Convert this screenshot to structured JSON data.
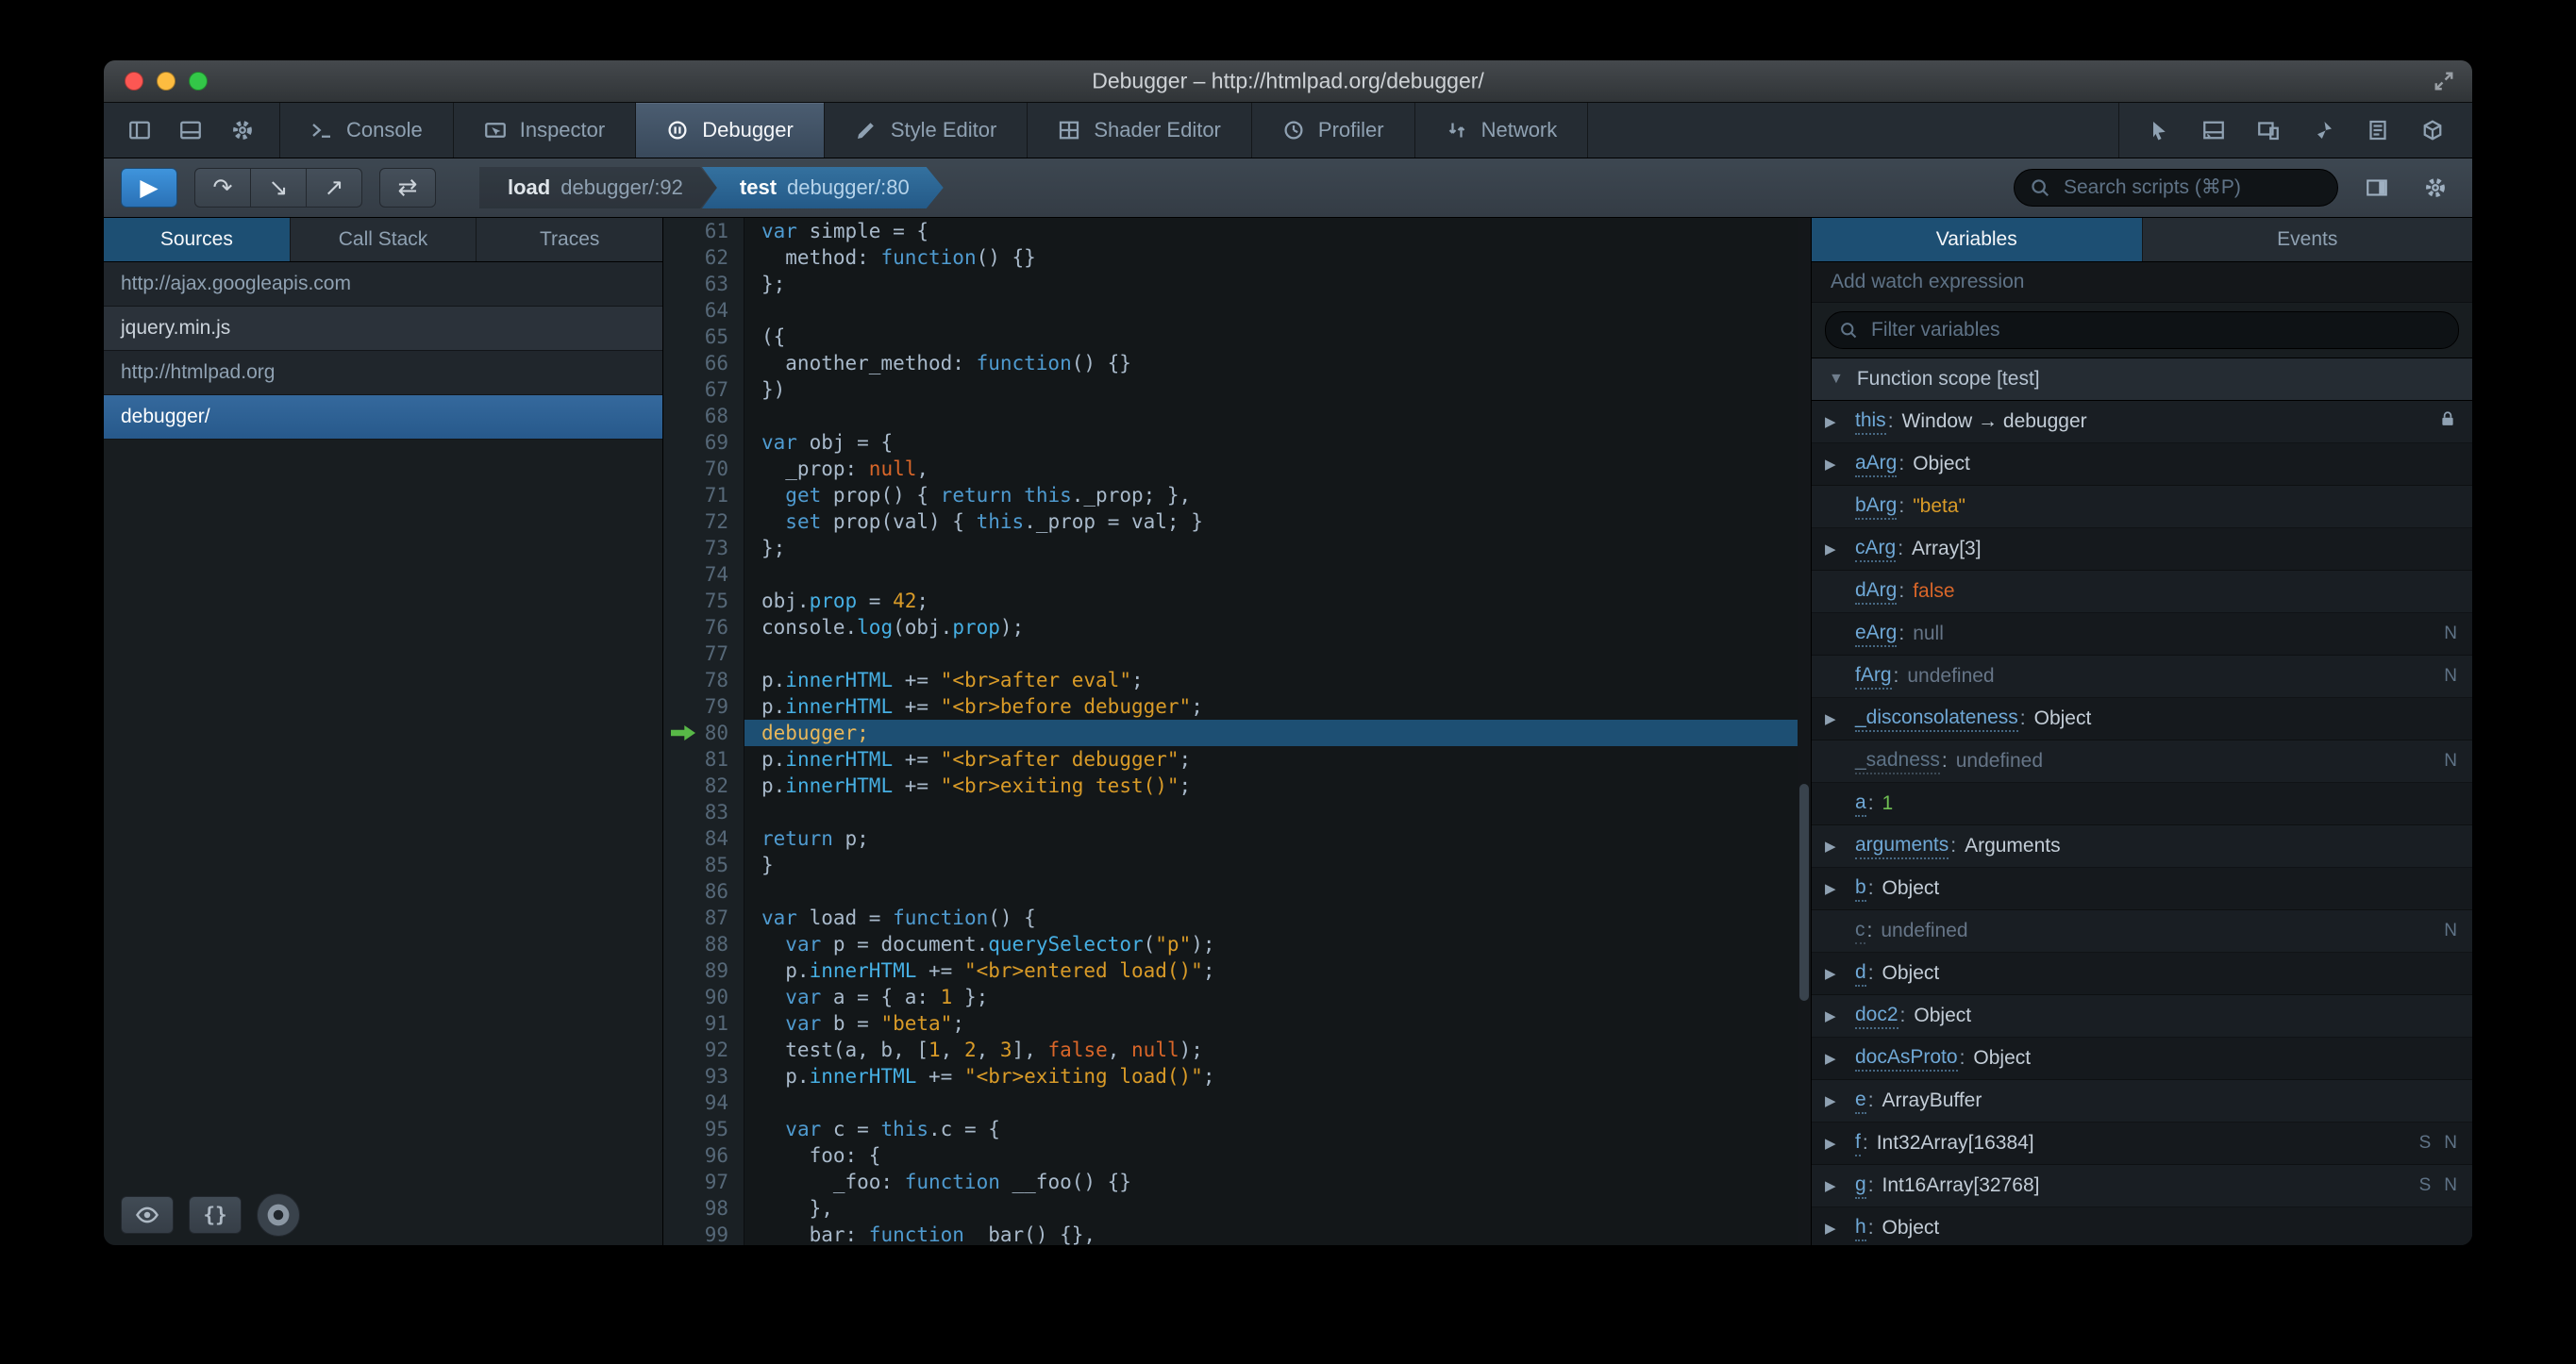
{
  "window": {
    "title": "Debugger – http://htmlpad.org/debugger/"
  },
  "toolbox": {
    "left_icons": [
      {
        "name": "dock-side-icon"
      },
      {
        "name": "dock-bottom-icon"
      },
      {
        "name": "toolbox-options-gear-icon"
      }
    ],
    "tabs": [
      {
        "label": "Console",
        "icon": "console-tab-icon",
        "active": false
      },
      {
        "label": "Inspector",
        "icon": "inspector-tab-icon",
        "active": false
      },
      {
        "label": "Debugger",
        "icon": "debugger-tab-icon",
        "active": true
      },
      {
        "label": "Style Editor",
        "icon": "style-editor-tab-icon",
        "active": false
      },
      {
        "label": "Shader Editor",
        "icon": "shader-editor-tab-icon",
        "active": false
      },
      {
        "label": "Profiler",
        "icon": "profiler-tab-icon",
        "active": false
      },
      {
        "label": "Network",
        "icon": "network-tab-icon",
        "active": false
      }
    ],
    "right_icons": [
      {
        "name": "pick-element-icon"
      },
      {
        "name": "split-console-icon"
      },
      {
        "name": "responsive-design-icon"
      },
      {
        "name": "paint-flashing-icon"
      },
      {
        "name": "scratchpad-icon"
      },
      {
        "name": "tilt-icon"
      }
    ]
  },
  "debugger_toolbar": {
    "button_groups": [
      [
        {
          "name": "resume-button",
          "icon": "resume-icon",
          "primary": true
        }
      ],
      [
        {
          "name": "step-over-button",
          "icon": "step-over-icon"
        },
        {
          "name": "step-in-button",
          "icon": "step-in-icon"
        },
        {
          "name": "step-out-button",
          "icon": "step-out-icon"
        }
      ],
      [
        {
          "name": "toggle-panes-button",
          "icon": "swap-icon"
        }
      ]
    ],
    "breadcrumbs": [
      {
        "fn": "load",
        "location": "debugger/:92",
        "active": false
      },
      {
        "fn": "test",
        "location": "debugger/:80",
        "active": true
      }
    ],
    "search_placeholder": "Search scripts (⌘P)"
  },
  "sources_panel": {
    "tabs": [
      {
        "label": "Sources",
        "active": true
      },
      {
        "label": "Call Stack",
        "active": false
      },
      {
        "label": "Traces",
        "active": false
      }
    ],
    "items": [
      {
        "label": "http://ajax.googleapis.com",
        "type": "group"
      },
      {
        "label": "jquery.min.js",
        "type": "file",
        "selected": false
      },
      {
        "label": "http://htmlpad.org",
        "type": "group"
      },
      {
        "label": "debugger/",
        "type": "file",
        "selected": true
      }
    ],
    "footer_buttons": [
      {
        "name": "blackbox-source-button",
        "icon": "eye-icon"
      },
      {
        "name": "prettyprint-button",
        "icon": "braces-icon"
      },
      {
        "name": "pause-on-exceptions-button",
        "icon": "pause-circle-icon",
        "shape": "round"
      }
    ]
  },
  "editor": {
    "first_line": 61,
    "debug_line": 80,
    "lines": [
      [
        [
          "k",
          "var"
        ],
        [
          "d",
          " simple = {"
        ]
      ],
      [
        [
          "d",
          "  method: "
        ],
        [
          "k",
          "function"
        ],
        [
          "d",
          "() {}"
        ]
      ],
      [
        [
          "d",
          "};"
        ]
      ],
      [],
      [
        [
          "d",
          "({"
        ]
      ],
      [
        [
          "d",
          "  another_method: "
        ],
        [
          "k",
          "function"
        ],
        [
          "d",
          "() {}"
        ]
      ],
      [
        [
          "d",
          "})"
        ]
      ],
      [],
      [
        [
          "k",
          "var"
        ],
        [
          "d",
          " obj = {"
        ]
      ],
      [
        [
          "d",
          "  _prop: "
        ],
        [
          "a",
          "null"
        ],
        [
          "d",
          ","
        ]
      ],
      [
        [
          "d",
          "  "
        ],
        [
          "k",
          "get"
        ],
        [
          "d",
          " prop() { "
        ],
        [
          "k",
          "return"
        ],
        [
          "d",
          " "
        ],
        [
          "k",
          "this"
        ],
        [
          "d",
          "._prop; },"
        ]
      ],
      [
        [
          "d",
          "  "
        ],
        [
          "k",
          "set"
        ],
        [
          "d",
          " prop(val) { "
        ],
        [
          "k",
          "this"
        ],
        [
          "d",
          "._prop = val; }"
        ]
      ],
      [
        [
          "d",
          "};"
        ]
      ],
      [],
      [
        [
          "d",
          "obj."
        ],
        [
          "p",
          "prop"
        ],
        [
          "d",
          " = "
        ],
        [
          "n",
          "42"
        ],
        [
          "d",
          ";"
        ]
      ],
      [
        [
          "d",
          "console."
        ],
        [
          "p",
          "log"
        ],
        [
          "d",
          "(obj."
        ],
        [
          "p",
          "prop"
        ],
        [
          "d",
          ");"
        ]
      ],
      [],
      [
        [
          "d",
          "p."
        ],
        [
          "p",
          "innerHTML"
        ],
        [
          "d",
          " += "
        ],
        [
          "s",
          "\"<br>after eval\""
        ],
        [
          "d",
          ";"
        ]
      ],
      [
        [
          "d",
          "p."
        ],
        [
          "p",
          "innerHTML"
        ],
        [
          "d",
          " += "
        ],
        [
          "s",
          "\"<br>before debugger\""
        ],
        [
          "d",
          ";"
        ]
      ],
      [
        [
          "dbg",
          "debugger;"
        ]
      ],
      [
        [
          "d",
          "p."
        ],
        [
          "p",
          "innerHTML"
        ],
        [
          "d",
          " += "
        ],
        [
          "s",
          "\"<br>after debugger\""
        ],
        [
          "d",
          ";"
        ]
      ],
      [
        [
          "d",
          "p."
        ],
        [
          "p",
          "innerHTML"
        ],
        [
          "d",
          " += "
        ],
        [
          "s",
          "\"<br>exiting test()\""
        ],
        [
          "d",
          ";"
        ]
      ],
      [],
      [
        [
          "k",
          "return"
        ],
        [
          "d",
          " p;"
        ]
      ],
      [
        [
          "d",
          "}"
        ]
      ],
      [],
      [
        [
          "k",
          "var"
        ],
        [
          "d",
          " load = "
        ],
        [
          "k",
          "function"
        ],
        [
          "d",
          "() {"
        ]
      ],
      [
        [
          "d",
          "  "
        ],
        [
          "k",
          "var"
        ],
        [
          "d",
          " p = document."
        ],
        [
          "p",
          "querySelector"
        ],
        [
          "d",
          "("
        ],
        [
          "s",
          "\"p\""
        ],
        [
          "d",
          ");"
        ]
      ],
      [
        [
          "d",
          "  p."
        ],
        [
          "p",
          "innerHTML"
        ],
        [
          "d",
          " += "
        ],
        [
          "s",
          "\"<br>entered load()\""
        ],
        [
          "d",
          ";"
        ]
      ],
      [
        [
          "d",
          "  "
        ],
        [
          "k",
          "var"
        ],
        [
          "d",
          " a = { a: "
        ],
        [
          "n",
          "1"
        ],
        [
          "d",
          " };"
        ]
      ],
      [
        [
          "d",
          "  "
        ],
        [
          "k",
          "var"
        ],
        [
          "d",
          " b = "
        ],
        [
          "s",
          "\"beta\""
        ],
        [
          "d",
          ";"
        ]
      ],
      [
        [
          "d",
          "  test(a, b, ["
        ],
        [
          "n",
          "1"
        ],
        [
          "d",
          ", "
        ],
        [
          "n",
          "2"
        ],
        [
          "d",
          ", "
        ],
        [
          "n",
          "3"
        ],
        [
          "d",
          "], "
        ],
        [
          "a",
          "false"
        ],
        [
          "d",
          ", "
        ],
        [
          "a",
          "null"
        ],
        [
          "d",
          ");"
        ]
      ],
      [
        [
          "d",
          "  p."
        ],
        [
          "p",
          "innerHTML"
        ],
        [
          "d",
          " += "
        ],
        [
          "s",
          "\"<br>exiting load()\""
        ],
        [
          "d",
          ";"
        ]
      ],
      [],
      [
        [
          "d",
          "  "
        ],
        [
          "k",
          "var"
        ],
        [
          "d",
          " c = "
        ],
        [
          "k",
          "this"
        ],
        [
          "d",
          ".c = {"
        ]
      ],
      [
        [
          "d",
          "    foo: {"
        ]
      ],
      [
        [
          "d",
          "      _foo: "
        ],
        [
          "k",
          "function"
        ],
        [
          "d",
          " __foo() {}"
        ]
      ],
      [
        [
          "d",
          "    },"
        ]
      ],
      [
        [
          "d",
          "    bar: "
        ],
        [
          "k",
          "function"
        ],
        [
          "d",
          " _bar() {},"
        ]
      ]
    ]
  },
  "variables_panel": {
    "tabs": [
      {
        "label": "Variables",
        "active": true
      },
      {
        "label": "Events",
        "active": false
      }
    ],
    "watch_label": "Add watch expression",
    "filter_placeholder": "Filter variables",
    "scope_label": "Function scope [test]",
    "variables": [
      {
        "name": "this",
        "value": "Window → debugger",
        "type": "obj",
        "expander": true,
        "badges": [
          "lock"
        ]
      },
      {
        "name": "aArg",
        "value": "Object",
        "type": "obj",
        "expander": true
      },
      {
        "name": "bArg",
        "value": "\"beta\"",
        "type": "string"
      },
      {
        "name": "cArg",
        "value": "Array[3]",
        "type": "obj",
        "expander": true
      },
      {
        "name": "dArg",
        "value": "false",
        "type": "bool"
      },
      {
        "name": "eArg",
        "value": "null",
        "type": "null",
        "badges": [
          "N"
        ]
      },
      {
        "name": "fArg",
        "value": "undefined",
        "type": "undefined",
        "badges": [
          "N"
        ]
      },
      {
        "name": "_disconsolateness",
        "value": "Object",
        "type": "obj",
        "expander": true
      },
      {
        "name": "_sadness",
        "value": "undefined",
        "type": "undefined",
        "dim": true,
        "badges": [
          "N"
        ]
      },
      {
        "name": "a",
        "value": "1",
        "type": "number"
      },
      {
        "name": "arguments",
        "value": "Arguments",
        "type": "obj",
        "expander": true
      },
      {
        "name": "b",
        "value": "Object",
        "type": "obj",
        "expander": true
      },
      {
        "name": "c",
        "value": "undefined",
        "type": "undefined",
        "dim": true,
        "badges": [
          "N"
        ]
      },
      {
        "name": "d",
        "value": "Object",
        "type": "obj",
        "expander": true
      },
      {
        "name": "doc2",
        "value": "Object",
        "type": "obj",
        "expander": true
      },
      {
        "name": "docAsProto",
        "value": "Object",
        "type": "obj",
        "expander": true
      },
      {
        "name": "e",
        "value": "ArrayBuffer",
        "type": "obj",
        "expander": true
      },
      {
        "name": "f",
        "value": "Int32Array[16384]",
        "type": "obj",
        "expander": true,
        "badges": [
          "S",
          "N"
        ]
      },
      {
        "name": "g",
        "value": "Int16Array[32768]",
        "type": "obj",
        "expander": true,
        "badges": [
          "S",
          "N"
        ]
      },
      {
        "name": "h",
        "value": "Object",
        "type": "obj",
        "expander": true
      }
    ]
  }
}
